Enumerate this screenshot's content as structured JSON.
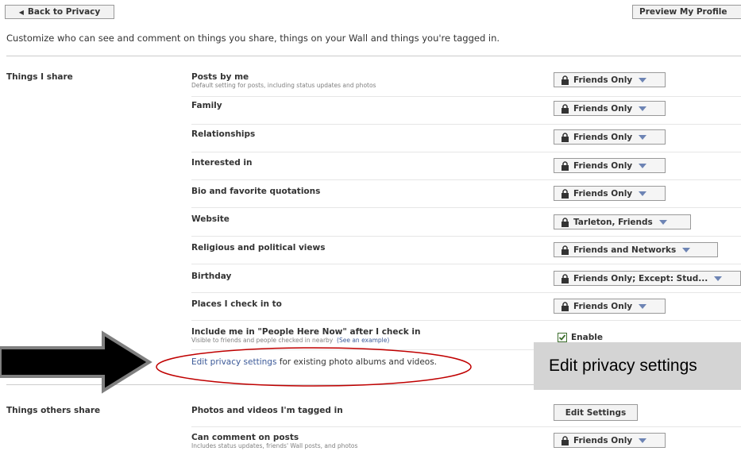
{
  "header": {
    "back_button": "Back to Privacy",
    "preview_button": "Preview My Profile"
  },
  "intro_text": "Customize who can see and comment on things you share, things on your Wall and things you're tagged in.",
  "section_things_i_share": {
    "label": "Things I share",
    "rows": [
      {
        "title": "Posts by me",
        "subtitle": "Default setting for posts, including status updates and photos",
        "setting": "Friends Only"
      },
      {
        "title": "Family",
        "setting": "Friends Only"
      },
      {
        "title": "Relationships",
        "setting": "Friends Only"
      },
      {
        "title": "Interested in",
        "setting": "Friends Only"
      },
      {
        "title": "Bio and favorite quotations",
        "setting": "Friends Only"
      },
      {
        "title": "Website",
        "setting": "Tarleton, Friends"
      },
      {
        "title": "Religious and political views",
        "setting": "Friends and Networks"
      },
      {
        "title": "Birthday",
        "setting": "Friends Only; Except: Stud..."
      },
      {
        "title": "Places I check in to",
        "setting": "Friends Only"
      }
    ],
    "people_here_now": {
      "title": "Include me in \"People Here Now\" after I check in",
      "subtitle": "Visible to friends and people checked in nearby",
      "example_link": "(See an example)",
      "checkbox_label": "Enable",
      "checked": true
    },
    "edit_privacy": {
      "link": "Edit privacy settings",
      "rest": " for existing photo albums and videos."
    }
  },
  "section_things_others_share": {
    "label": "Things others share",
    "rows": [
      {
        "title": "Photos and videos I'm tagged in",
        "button": "Edit Settings"
      },
      {
        "title": "Can comment on posts",
        "subtitle": "Includes status updates, friends' Wall posts, and photos",
        "setting": "Friends Only"
      }
    ]
  },
  "callout": {
    "text": "Edit privacy settings",
    "color": "#d4d4d4"
  },
  "colors": {
    "link": "#3b5998",
    "annotation": "#c00000",
    "arrow": "#000000"
  }
}
